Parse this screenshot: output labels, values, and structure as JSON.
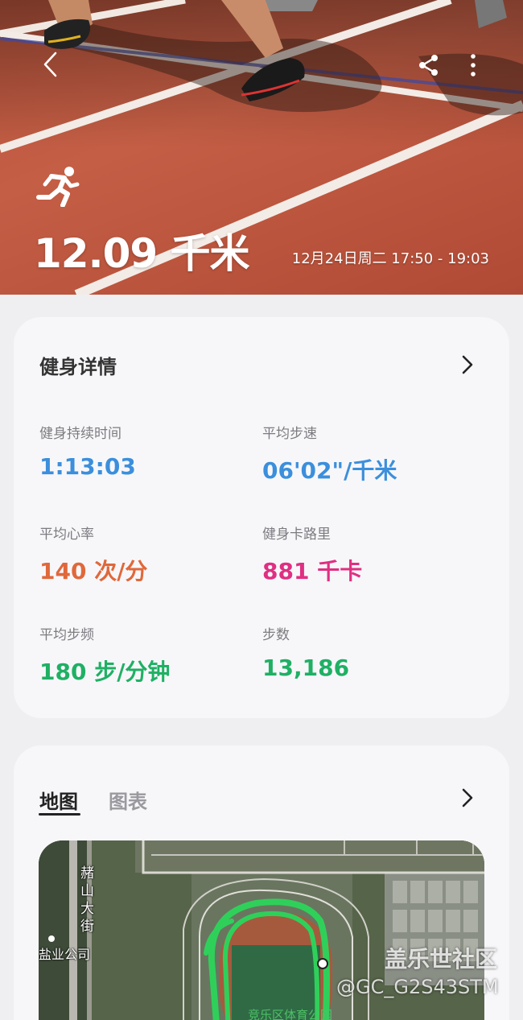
{
  "header": {
    "distance": "12.09 千米",
    "date_range": "12月24日周二 17:50 - 19:03"
  },
  "details": {
    "title": "健身详情",
    "metrics": [
      {
        "label": "健身持续时间",
        "value": "1:13:03",
        "color": "#3b8fdc"
      },
      {
        "label": "平均步速",
        "value": "06'02\"/千米",
        "color": "#3b8fdc"
      },
      {
        "label": "平均心率",
        "value": "140 次/分",
        "color": "#e0683a"
      },
      {
        "label": "健身卡路里",
        "value": "881 千卡",
        "color": "#e02f82"
      },
      {
        "label": "平均步频",
        "value": "180 步/分钟",
        "color": "#1fb064"
      },
      {
        "label": "步数",
        "value": "13,186",
        "color": "#1fb064"
      }
    ]
  },
  "map_card": {
    "tabs": [
      "地图",
      "图表"
    ],
    "active_tab": "地图",
    "labels": {
      "street": "赭山大街",
      "company": "盐业公司",
      "venue": "竞乐区体育公园"
    }
  },
  "watermark": {
    "line1": "盖乐世社区",
    "line2": "@GC_G2S43STM"
  },
  "icons": {
    "back": "chevron-left-icon",
    "share": "share-icon",
    "more": "more-vertical-icon",
    "activity": "running-icon",
    "details_arrow": "chevron-right-icon",
    "map_arrow": "chevron-right-icon"
  }
}
